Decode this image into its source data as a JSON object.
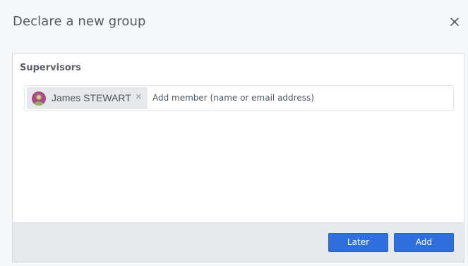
{
  "dialog": {
    "title": "Declare a new group",
    "close_icon": "close-icon"
  },
  "supervisors": {
    "label": "Supervisors",
    "members": [
      {
        "name": "James STEWART",
        "avatar_color": "#b04a86"
      }
    ],
    "remove_symbol": "×",
    "input_placeholder": "Add member (name or email address)",
    "input_value": ""
  },
  "footer": {
    "later_label": "Later",
    "add_label": "Add"
  },
  "colors": {
    "primary_button": "#2f6fdc",
    "footer_bg": "#e8e9ed",
    "page_bg": "#f6f7f9"
  }
}
